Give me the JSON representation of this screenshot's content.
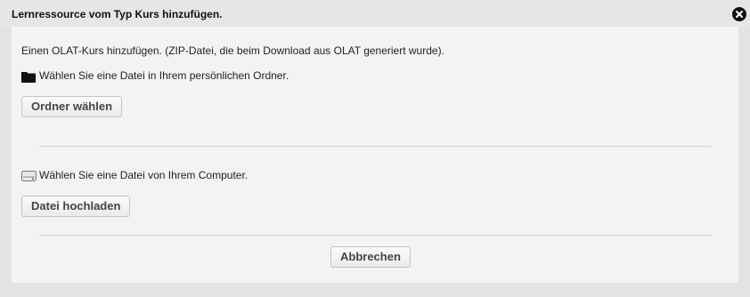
{
  "dialog": {
    "title": "Lernressource vom Typ Kurs hinzufügen.",
    "close_icon": "close-circle-icon"
  },
  "intro_text": "Einen OLAT-Kurs hinzufügen. (ZIP-Datei, die beim Download aus OLAT generiert wurde).",
  "folder_section": {
    "icon": "folder-icon",
    "text": "Wählen Sie eine Datei in Ihrem persönlichen Ordner.",
    "button_label": "Ordner wählen"
  },
  "upload_section": {
    "icon": "hard-drive-icon",
    "text": "Wählen Sie eine Datei von Ihrem Computer.",
    "button_label": "Datei hochladen"
  },
  "cancel_label": "Abbrechen"
}
